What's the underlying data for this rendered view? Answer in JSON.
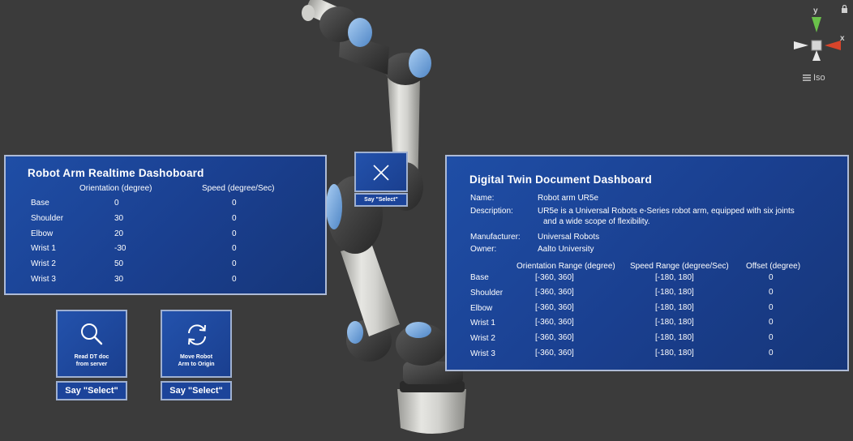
{
  "left_panel": {
    "title": "Robot Arm Realtime Dashoboard",
    "col_orientation": "Orientation (degree)",
    "col_speed": "Speed (degree/Sec)",
    "rows": [
      {
        "joint": "Base",
        "orientation": "0",
        "speed": "0"
      },
      {
        "joint": "Shoulder",
        "orientation": "30",
        "speed": "0"
      },
      {
        "joint": "Elbow",
        "orientation": "20",
        "speed": "0"
      },
      {
        "joint": "Wrist 1",
        "orientation": "-30",
        "speed": "0"
      },
      {
        "joint": "Wrist 2",
        "orientation": "50",
        "speed": "0"
      },
      {
        "joint": "Wrist 3",
        "orientation": "30",
        "speed": "0"
      }
    ]
  },
  "buttons": {
    "read_doc": {
      "line1": "Read DT doc",
      "line2": "from server",
      "say": "Say \"Select\""
    },
    "move_origin": {
      "line1": "Move Robot",
      "line2": "Arm to Origin",
      "say": "Say \"Select\""
    },
    "close": {
      "say": "Say \"Select\""
    }
  },
  "right_panel": {
    "title": "Digital Twin Document Dashboard",
    "name_label": "Name:",
    "name_value": "Robot arm UR5e",
    "description_label": "Description:",
    "description_line1": "UR5e is a Universal Robots e-Series robot arm, equipped with six joints",
    "description_line2": "and a wide scope of flexibility.",
    "manufacturer_label": "Manufacturer:",
    "manufacturer_value": "Universal Robots",
    "owner_label": "Owner:",
    "owner_value": "Aalto University",
    "col_orientation_range": "Orientation Range (degree)",
    "col_speed_range": "Speed Range (degree/Sec)",
    "col_offset": "Offset (degree)",
    "rows": [
      {
        "joint": "Base",
        "orientation_range": "[-360, 360]",
        "speed_range": "[-180, 180]",
        "offset": "0"
      },
      {
        "joint": "Shoulder",
        "orientation_range": "[-360, 360]",
        "speed_range": "[-180, 180]",
        "offset": "0"
      },
      {
        "joint": "Elbow",
        "orientation_range": "[-360, 360]",
        "speed_range": "[-180, 180]",
        "offset": "0"
      },
      {
        "joint": "Wrist 1",
        "orientation_range": "[-360, 360]",
        "speed_range": "[-180, 180]",
        "offset": "0"
      },
      {
        "joint": "Wrist 2",
        "orientation_range": "[-360, 360]",
        "speed_range": "[-180, 180]",
        "offset": "0"
      },
      {
        "joint": "Wrist 3",
        "orientation_range": "[-360, 360]",
        "speed_range": "[-180, 180]",
        "offset": "0"
      }
    ]
  },
  "gizmo": {
    "y_label": "y",
    "x_label": "x",
    "view_label": "Iso"
  },
  "colors": {
    "background": "#3b3b3b",
    "panel_blue": "#1a3f8f",
    "joint_blue": "#6fa2d8",
    "axis_y": "#6ac14a",
    "axis_x": "#d8442a"
  },
  "icons": [
    "close-icon",
    "search-icon",
    "refresh-icon",
    "lock-icon",
    "menu-icon"
  ]
}
